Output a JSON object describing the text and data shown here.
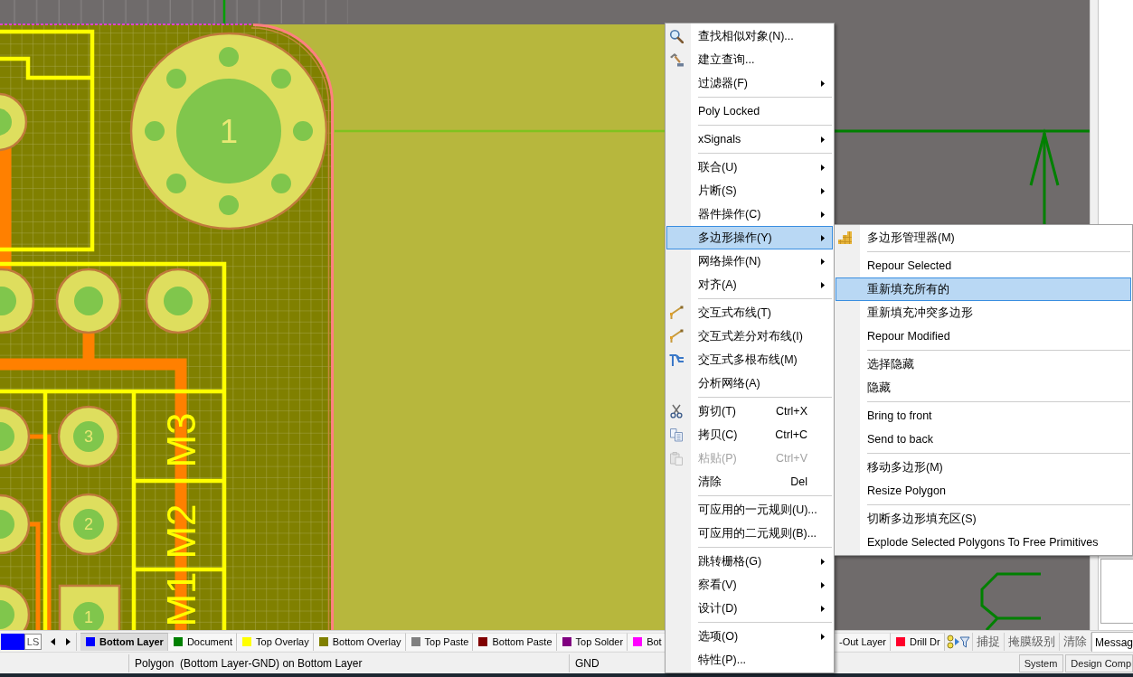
{
  "board": {
    "mounting_hole_label": "1",
    "pad_numbers": [
      "3",
      "2",
      "1"
    ],
    "designators": [
      "M3",
      "M2",
      "M1"
    ]
  },
  "context_menu": {
    "groups": [
      {
        "items": [
          {
            "label": "查找相似对象(N)...",
            "has_submenu": false,
            "selected": false,
            "disabled": false
          },
          {
            "label": "建立查询...",
            "has_submenu": false,
            "selected": false,
            "disabled": false
          },
          {
            "label": "过滤器(F)",
            "has_submenu": true,
            "selected": false,
            "disabled": false
          }
        ]
      },
      {
        "items": [
          {
            "label": "Poly Locked",
            "has_submenu": false,
            "selected": false,
            "disabled": false
          }
        ]
      },
      {
        "items": [
          {
            "label": "xSignals",
            "has_submenu": true,
            "selected": false,
            "disabled": false
          }
        ]
      },
      {
        "items": [
          {
            "label": "联合(U)",
            "has_submenu": true,
            "selected": false,
            "disabled": false
          },
          {
            "label": "片断(S)",
            "has_submenu": true,
            "selected": false,
            "disabled": false
          },
          {
            "label": "器件操作(C)",
            "has_submenu": true,
            "selected": false,
            "disabled": false
          },
          {
            "label": "多边形操作(Y)",
            "has_submenu": true,
            "selected": true,
            "disabled": false
          },
          {
            "label": "网络操作(N)",
            "has_submenu": true,
            "selected": false,
            "disabled": false
          },
          {
            "label": "对齐(A)",
            "has_submenu": true,
            "selected": false,
            "disabled": false
          }
        ]
      },
      {
        "items": [
          {
            "label": "交互式布线(T)",
            "has_submenu": false,
            "selected": false,
            "disabled": false
          },
          {
            "label": "交互式差分对布线(I)",
            "has_submenu": false,
            "selected": false,
            "disabled": false
          },
          {
            "label": "交互式多根布线(M)",
            "has_submenu": false,
            "selected": false,
            "disabled": false
          },
          {
            "label": "分析网络(A)",
            "has_submenu": false,
            "selected": false,
            "disabled": false
          }
        ]
      },
      {
        "items": [
          {
            "label": "剪切(T)",
            "shortcut": "Ctrl+X",
            "has_submenu": false,
            "selected": false,
            "disabled": false
          },
          {
            "label": "拷贝(C)",
            "shortcut": "Ctrl+C",
            "has_submenu": false,
            "selected": false,
            "disabled": false
          },
          {
            "label": "粘贴(P)",
            "shortcut": "Ctrl+V",
            "has_submenu": false,
            "selected": false,
            "disabled": true
          },
          {
            "label": "清除",
            "shortcut": "Del",
            "has_submenu": false,
            "selected": false,
            "disabled": false
          }
        ]
      },
      {
        "items": [
          {
            "label": "可应用的一元规则(U)...",
            "has_submenu": false,
            "selected": false,
            "disabled": false
          },
          {
            "label": "可应用的二元规则(B)...",
            "has_submenu": false,
            "selected": false,
            "disabled": false
          }
        ]
      },
      {
        "items": [
          {
            "label": "跳转栅格(G)",
            "has_submenu": true,
            "selected": false,
            "disabled": false
          },
          {
            "label": "察看(V)",
            "has_submenu": true,
            "selected": false,
            "disabled": false
          },
          {
            "label": "设计(D)",
            "has_submenu": true,
            "selected": false,
            "disabled": false
          }
        ]
      },
      {
        "items": [
          {
            "label": "选项(O)",
            "has_submenu": true,
            "selected": false,
            "disabled": false
          },
          {
            "label": "特性(P)...",
            "has_submenu": false,
            "selected": false,
            "disabled": false
          }
        ]
      }
    ]
  },
  "submenu": {
    "groups": [
      {
        "items": [
          {
            "label": "多边形管理器(M)",
            "selected": false
          }
        ]
      },
      {
        "items": [
          {
            "label": "Repour Selected",
            "selected": false
          },
          {
            "label": "重新填充所有的",
            "selected": true
          },
          {
            "label": "重新填充冲突多边形",
            "selected": false
          },
          {
            "label": "Repour Modified",
            "selected": false
          }
        ]
      },
      {
        "items": [
          {
            "label": "选择隐藏",
            "selected": false
          },
          {
            "label": "隐藏",
            "selected": false
          }
        ]
      },
      {
        "items": [
          {
            "label": "Bring to front",
            "selected": false
          },
          {
            "label": "Send to back",
            "selected": false
          }
        ]
      },
      {
        "items": [
          {
            "label": "移动多边形(M)",
            "selected": false
          },
          {
            "label": "Resize Polygon",
            "selected": false
          }
        ]
      },
      {
        "items": [
          {
            "label": "切断多边形填充区(S)",
            "selected": false
          },
          {
            "label": "Explode Selected Polygons To Free Primitives",
            "selected": false
          }
        ]
      }
    ]
  },
  "layer_bar": {
    "layer_set_button": "LS",
    "tabs": [
      {
        "label": "Bottom Layer",
        "color": "#0000ff",
        "selected": true
      },
      {
        "label": "Document",
        "color": "#008000",
        "selected": false
      },
      {
        "label": "Top Overlay",
        "color": "#ffff00",
        "selected": false
      },
      {
        "label": "Bottom Overlay",
        "color": "#808000",
        "selected": false
      },
      {
        "label": "Top Paste",
        "color": "#808080",
        "selected": false
      },
      {
        "label": "Bottom Paste",
        "color": "#800000",
        "selected": false
      },
      {
        "label": "Top Solder",
        "color": "#800080",
        "selected": false
      },
      {
        "label": "Bot",
        "color": "#ff00ff",
        "selected": false
      }
    ],
    "tabs_after_menu": [
      {
        "label": "-Out Layer",
        "selected": false
      },
      {
        "label": "Drill Dr",
        "color": "#ff002a",
        "selected": false
      }
    ],
    "buttons": [
      "捕捉",
      "掩膜级别",
      "清除"
    ]
  },
  "panel_tabs": [
    {
      "label": "Messag",
      "selected": true
    }
  ],
  "status_bar": {
    "message": "Polygon  (Bottom Layer-GND) on Bottom Layer",
    "net": "GND",
    "buttons": [
      "System",
      "Design Comp"
    ]
  }
}
